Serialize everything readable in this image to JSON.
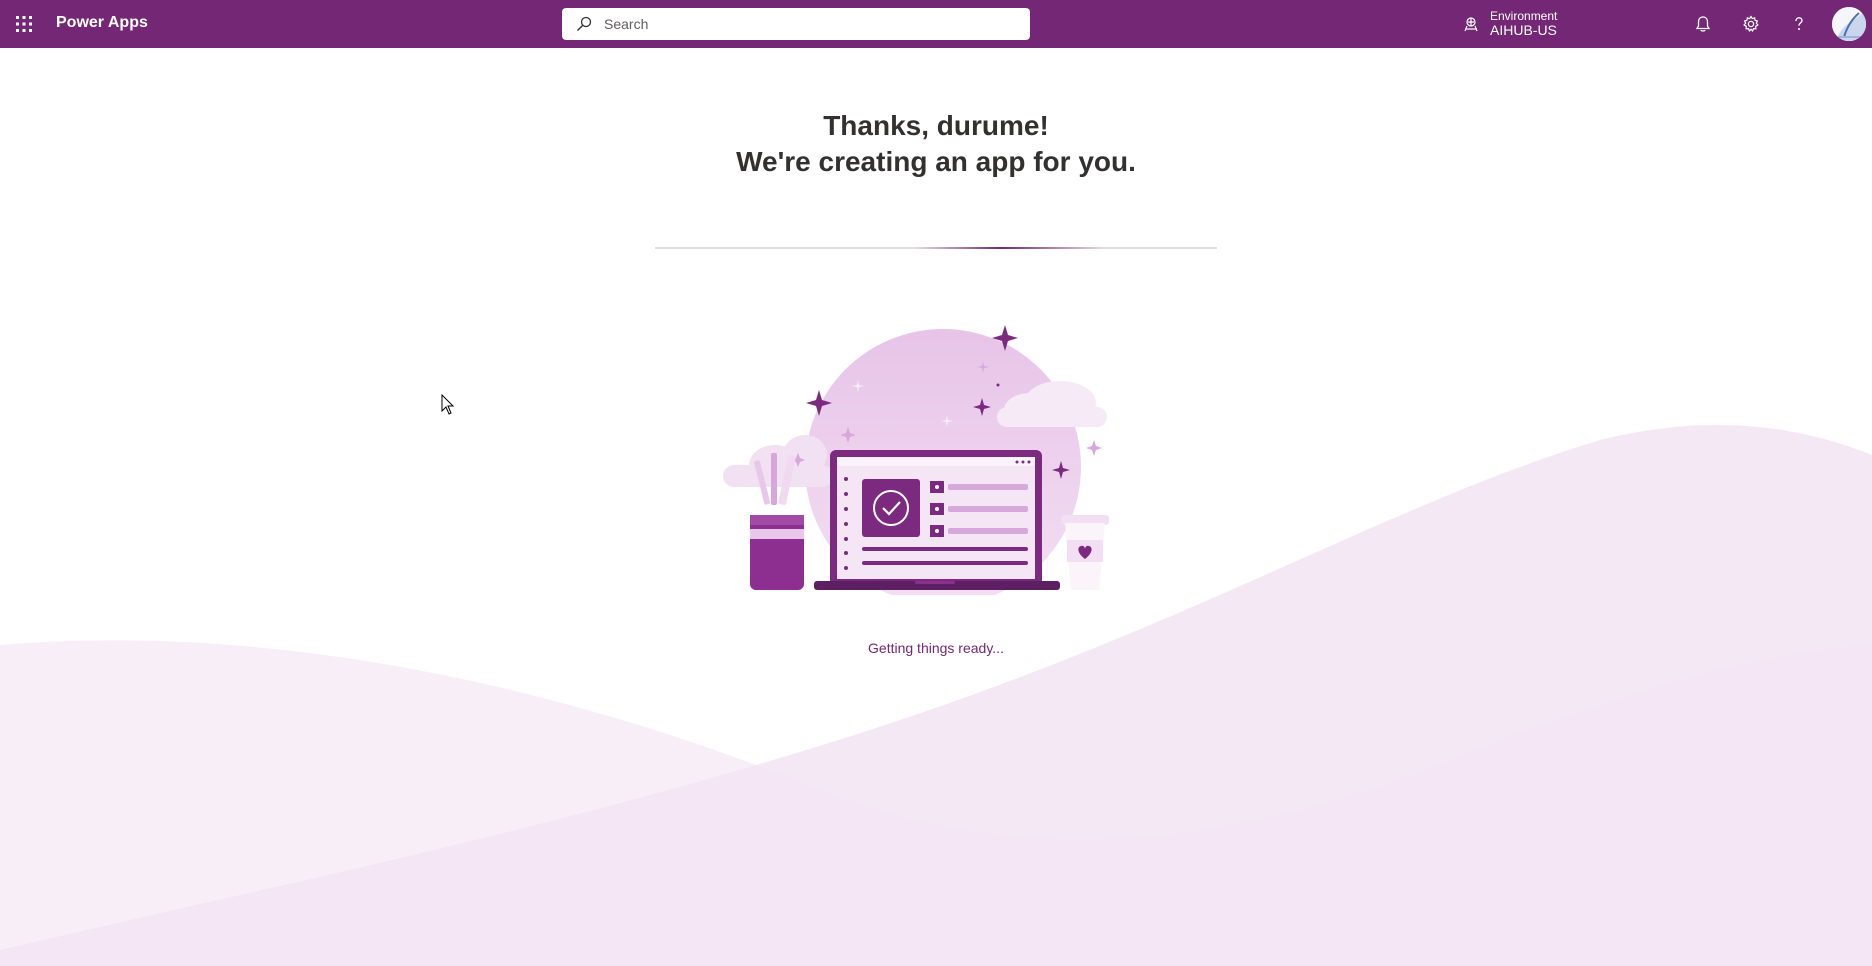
{
  "header": {
    "app_title": "Power Apps",
    "search_placeholder": "Search",
    "environment_label": "Environment",
    "environment_name": "AIHUB-US",
    "icons": [
      "waffle-icon",
      "search-icon",
      "environment-icon",
      "bell-icon",
      "gear-icon",
      "help-icon",
      "avatar"
    ]
  },
  "main": {
    "heading_line1": "Thanks, durume!",
    "heading_line2": "We're creating an app for you.",
    "status_text": "Getting things ready..."
  },
  "colors": {
    "brand": "#742774",
    "accent_light": "#f3e6f3",
    "text": "#323130"
  }
}
